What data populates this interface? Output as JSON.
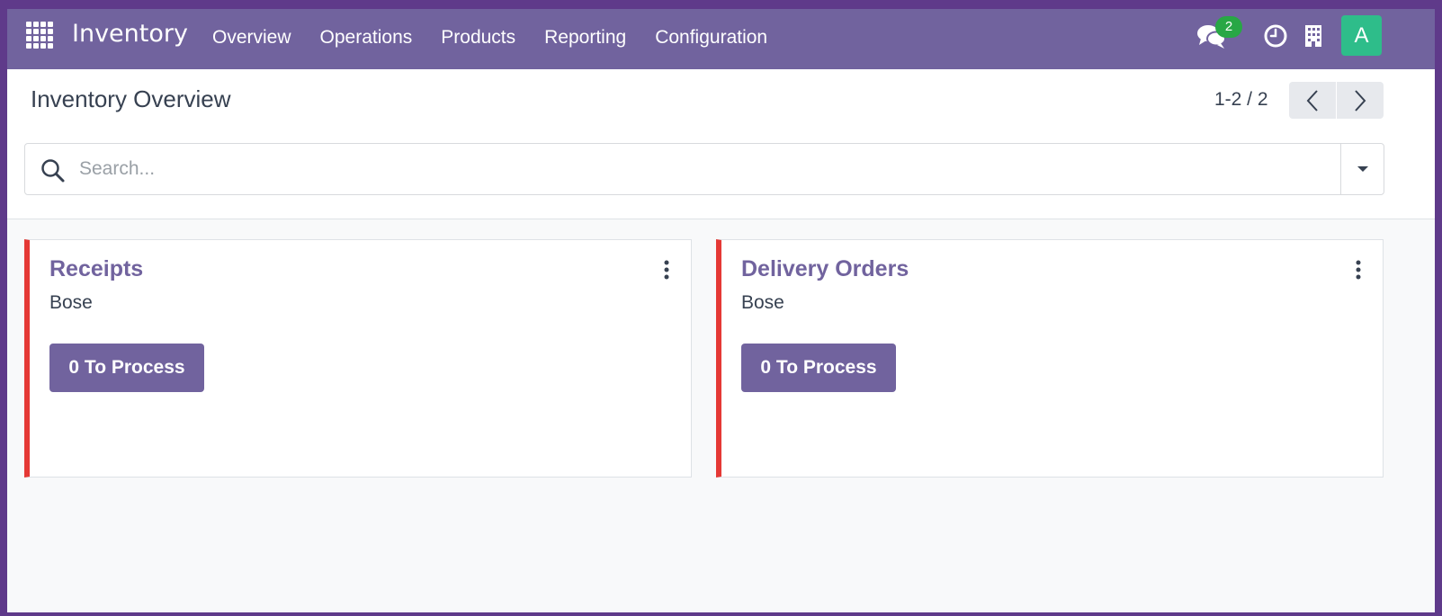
{
  "navbar": {
    "app_name": "Inventory",
    "menu": [
      "Overview",
      "Operations",
      "Products",
      "Reporting",
      "Configuration"
    ],
    "chat_badge": "2",
    "avatar_initial": "A",
    "bg_color": "#71639e",
    "avatar_color": "#2ebd8a",
    "badge_color": "#28a745"
  },
  "control_panel": {
    "title": "Inventory Overview",
    "pager": "1-2 / 2",
    "search_placeholder": "Search..."
  },
  "cards": [
    {
      "title": "Receipts",
      "subtitle": "Bose",
      "button": "0 To Process",
      "accent": "#e53935"
    },
    {
      "title": "Delivery Orders",
      "subtitle": "Bose",
      "button": "0 To Process",
      "accent": "#e53935"
    }
  ],
  "icons": [
    "apps-grid-icon",
    "chat-icon",
    "clock-icon",
    "building-icon",
    "search-icon",
    "caret-down-icon",
    "chevron-left-icon",
    "chevron-right-icon",
    "kebab-menu-icon"
  ]
}
